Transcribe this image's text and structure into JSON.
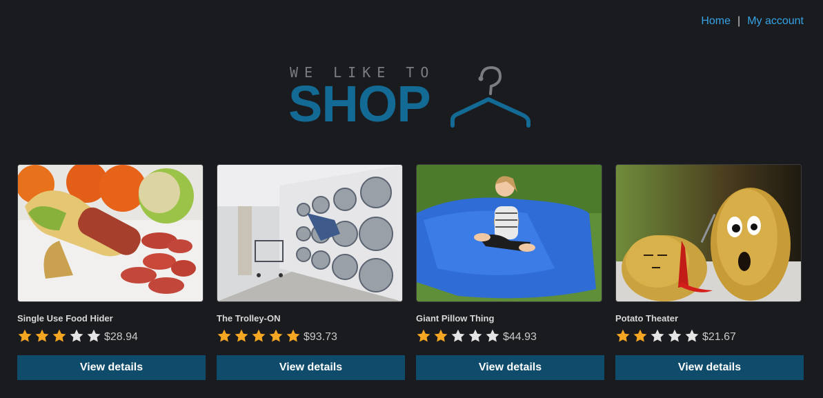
{
  "nav": {
    "home": "Home",
    "separator": "|",
    "account": "My account"
  },
  "logo": {
    "tagline": "WE LIKE TO",
    "word": "SHOP",
    "icon": "hanger-icon"
  },
  "products": [
    {
      "name": "Single Use Food Hider",
      "price": "$28.94",
      "rating": 3,
      "max_rating": 5,
      "button": "View details",
      "image": "food-image"
    },
    {
      "name": "The Trolley-ON",
      "price": "$93.73",
      "rating": 5,
      "max_rating": 5,
      "button": "View details",
      "image": "laundromat-image"
    },
    {
      "name": "Giant Pillow Thing",
      "price": "$44.93",
      "rating": 2,
      "max_rating": 5,
      "button": "View details",
      "image": "pillow-image"
    },
    {
      "name": "Potato Theater",
      "price": "$21.67",
      "rating": 2,
      "max_rating": 5,
      "button": "View details",
      "image": "potato-image"
    }
  ],
  "colors": {
    "background": "#1a1b1e",
    "link": "#36a3e6",
    "brand": "#136a94",
    "button": "#0f4b6b",
    "star_on": "#f5a623",
    "star_off": "#e4e4e4"
  }
}
